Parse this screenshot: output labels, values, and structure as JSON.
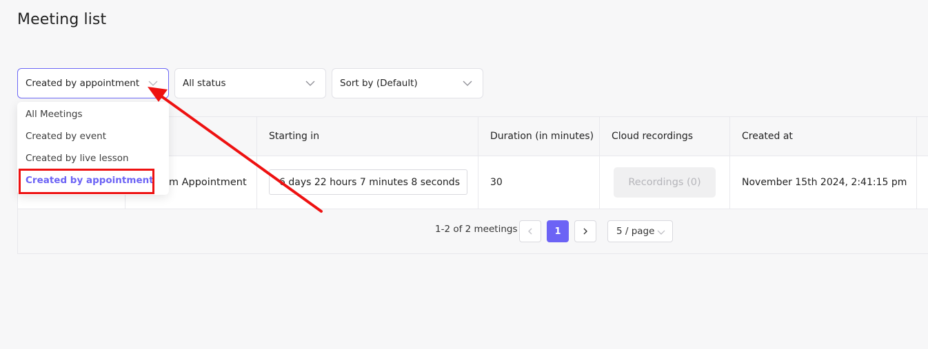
{
  "page": {
    "title": "Meeting list"
  },
  "filters": {
    "type_select": "Created by appointment",
    "status_select": "All status",
    "sort_select": "Sort by (Default)"
  },
  "dropdown": {
    "options": [
      "All Meetings",
      "Created by event",
      "Created by live lesson",
      "Created by appointment"
    ],
    "selected_index": 3
  },
  "table": {
    "columns": [
      "Starting in",
      "Duration (in minutes)",
      "Cloud recordings",
      "Created at"
    ],
    "rows": [
      {
        "title_partial": "om Appointment",
        "starting_in": "6 days 22 hours 7 minutes 8 seconds",
        "duration": "30",
        "recordings_label": "Recordings (0)",
        "created_at": "November 15th 2024, 2:41:15 pm"
      }
    ]
  },
  "pagination": {
    "summary": "1-2 of 2 meetings",
    "prev_icon": "chevron-left-icon",
    "current_page": "1",
    "next_icon": "chevron-right-icon",
    "page_size": "5 / page"
  },
  "annotation": {
    "color": "#ee1111"
  },
  "colors": {
    "accent": "#6c63f5",
    "annotation": "#ee1111"
  }
}
